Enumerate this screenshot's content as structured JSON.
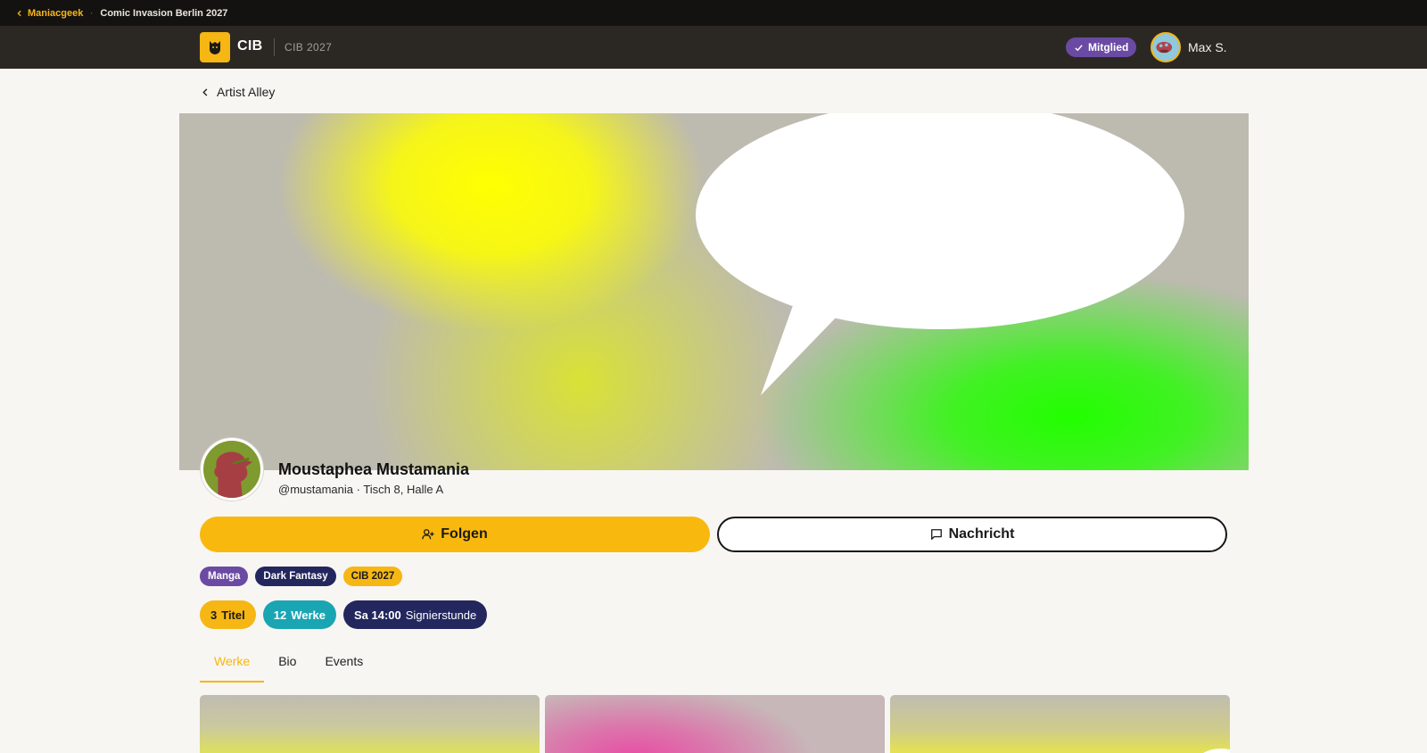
{
  "topbar": {
    "back_label": "Maniacgeek",
    "separator": "·",
    "event_name": "Comic Invasion Berlin 2027"
  },
  "header": {
    "brand": "CIB",
    "edition": "CIB 2027",
    "member_badge": "Mitglied",
    "user_name": "Max S."
  },
  "breadcrumb": {
    "label": "Artist Alley"
  },
  "profile": {
    "name": "Moustaphea Mustamania",
    "meta": "@mustamania · Tisch 8, Halle A"
  },
  "actions": {
    "follow_label": "Folgen",
    "message_label": "Nachricht"
  },
  "tags": [
    {
      "label": "Manga",
      "color": "#6a4aa3"
    },
    {
      "label": "Dark Fantasy",
      "color": "#23275e"
    },
    {
      "label": "CIB 2027",
      "color": "#f6b614"
    }
  ],
  "stats": {
    "titles": {
      "value": "3",
      "unit": "Titel",
      "color": "#f6b614"
    },
    "works": {
      "value": "12",
      "unit": "Werke",
      "color": "#1aa5b3"
    },
    "signing": {
      "value": "Sa 14:00",
      "unit": "Signierstunde",
      "color": "#23275e"
    }
  },
  "tabs": [
    {
      "label": "Werke",
      "active": true
    },
    {
      "label": "Bio",
      "active": false
    },
    {
      "label": "Events",
      "active": false
    }
  ],
  "colors": {
    "accent": "#f6b614",
    "member": "#6a4aa3",
    "navy": "#23275e",
    "teal": "#1aa5b3"
  },
  "icons": {
    "back": "chevron-left-icon",
    "logo": "mascot-icon",
    "member": "check-icon",
    "follow": "user-plus-icon",
    "message": "message-square-icon"
  }
}
